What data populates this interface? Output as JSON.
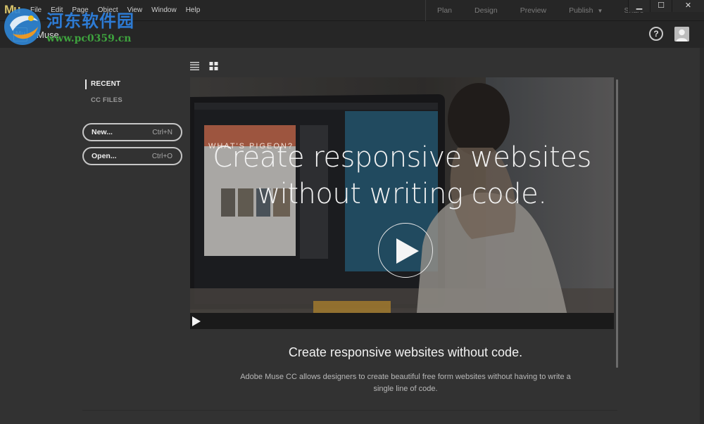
{
  "app": {
    "logo_text": "Mu",
    "mark_text": "Mu",
    "name": "Muse"
  },
  "menu": [
    "File",
    "Edit",
    "Page",
    "Object",
    "View",
    "Window",
    "Help"
  ],
  "modes": {
    "plan": "Plan",
    "design": "Design",
    "preview": "Preview",
    "publish": "Publish",
    "publish_arrow": "▼",
    "share": "Share"
  },
  "window_controls": {
    "minimize": "▁",
    "maximize": "☐",
    "close": "✕"
  },
  "watermark": {
    "cn": "河东软件园",
    "url": "www.pc0359.cn"
  },
  "help_icon": "?",
  "sidebar": {
    "recent": "RECENT",
    "cc_files": "CC FILES",
    "new_label": "New...",
    "new_shortcut": "Ctrl+N",
    "open_label": "Open...",
    "open_shortcut": "Ctrl+O"
  },
  "video": {
    "headline": "Create responsive websites\nwithout writing code.",
    "screen_text": "WHAT'S PIGEON?"
  },
  "caption": {
    "title": "Create responsive websites without code.",
    "body": "Adobe Muse CC allows designers to create beautiful free form websites without having to write a single line of code."
  },
  "colors": {
    "accent_muse": "#d4c16a",
    "background": "#323232",
    "menubar": "#262626"
  },
  "icons": {
    "list_view": "list-view-icon",
    "grid_view": "grid-view-icon",
    "play": "play-icon",
    "help": "help-icon",
    "avatar": "user-avatar-icon"
  }
}
